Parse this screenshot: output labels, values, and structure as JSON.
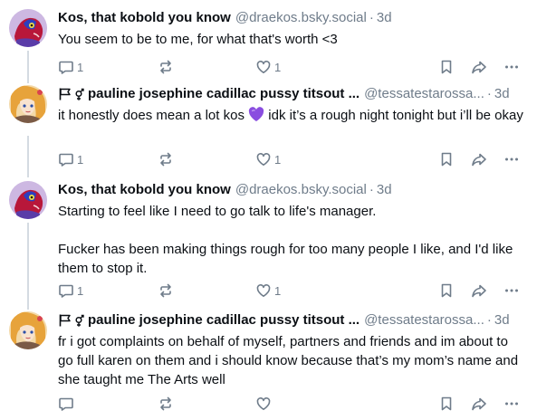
{
  "colors": {
    "muted": "#6f7c8a",
    "text": "#0b0f14",
    "thread_line": "#d4dbe2",
    "purple_heart": "#8a4ee0"
  },
  "posts": [
    {
      "author": "Kos, that kobold you know",
      "handle": "@draekos.bsky.social",
      "separator": "·",
      "time": "3d",
      "text": "You seem to be to me, for what that's worth <3",
      "reply_count": "1",
      "like_count": "1",
      "avatar": "kobold-avatar"
    },
    {
      "author": "pauline josephine cadillac pussy titsout ...",
      "handle": "@tessatestarossa...",
      "separator": "·",
      "time": "3d",
      "text_before_emoji": "it honestly does mean a lot kos ",
      "text_after_emoji": " idk it’s a rough night tonight but i’ll be okay",
      "emoji": "purple-heart",
      "reply_count": "1",
      "like_count": "1",
      "avatar": "anime-avatar"
    },
    {
      "author": "Kos, that kobold you know",
      "handle": "@draekos.bsky.social",
      "separator": "·",
      "time": "3d",
      "text": "Starting to feel like I need to go talk to life's manager.\n\nFucker has been making things rough for too many people I like, and I'd like them to stop it.",
      "reply_count": "1",
      "like_count": "1",
      "avatar": "kobold-avatar"
    },
    {
      "author": "pauline josephine cadillac pussy titsout ...",
      "handle": "@tessatestarossa...",
      "separator": "·",
      "time": "3d",
      "text": "fr i got complaints on behalf of myself, partners and friends and im about to go full karen on them and i should know because that’s my mom’s name and she taught me The Arts well",
      "reply_count": "",
      "like_count": "",
      "avatar": "anime-avatar"
    }
  ]
}
